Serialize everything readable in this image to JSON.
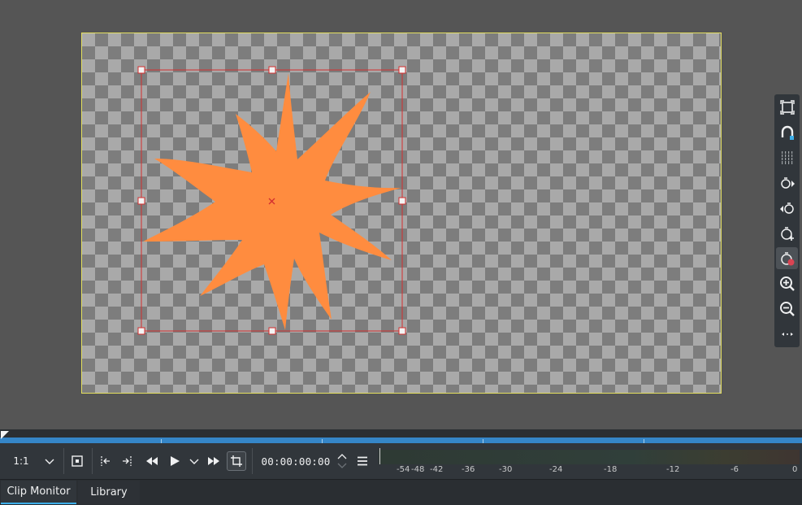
{
  "monitor": {
    "colors": {
      "background": "#555555",
      "frame_border": "#e5e060",
      "shape_fill": "#ff8c3f",
      "selection": "#d32f2f"
    },
    "side_toolbar": {
      "items": [
        {
          "icon": "fit-frame-icon"
        },
        {
          "icon": "magnet-snap-icon"
        },
        {
          "icon": "grid-icon"
        },
        {
          "icon": "next-keyframe-icon"
        },
        {
          "icon": "previous-keyframe-icon"
        },
        {
          "icon": "add-keyframe-icon"
        },
        {
          "icon": "remove-keyframe-icon",
          "active": true
        },
        {
          "icon": "zoom-in-icon"
        },
        {
          "icon": "zoom-out-icon"
        },
        {
          "icon": "more-options-icon"
        }
      ]
    }
  },
  "controls": {
    "zoom_ratio": "1:1",
    "timecode": "00:00:00:00"
  },
  "meter": {
    "labels": [
      "-54",
      "-48",
      "-42",
      "-36",
      "-30",
      "-24",
      "-18",
      "-12",
      "-6",
      "0"
    ]
  },
  "tabs": {
    "clip_monitor": "Clip Monitor",
    "library": "Library"
  }
}
